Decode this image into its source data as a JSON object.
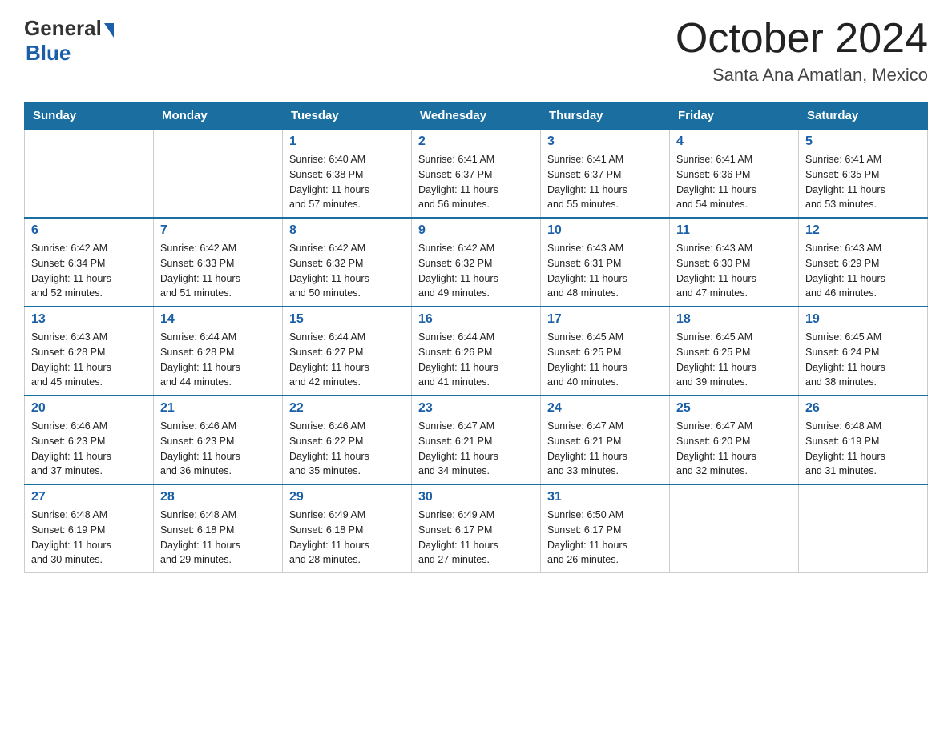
{
  "header": {
    "logo_general": "General",
    "logo_blue": "Blue",
    "month_title": "October 2024",
    "location": "Santa Ana Amatlan, Mexico"
  },
  "days_of_week": [
    "Sunday",
    "Monday",
    "Tuesday",
    "Wednesday",
    "Thursday",
    "Friday",
    "Saturday"
  ],
  "weeks": [
    [
      {
        "day": "",
        "info": ""
      },
      {
        "day": "",
        "info": ""
      },
      {
        "day": "1",
        "info": "Sunrise: 6:40 AM\nSunset: 6:38 PM\nDaylight: 11 hours\nand 57 minutes."
      },
      {
        "day": "2",
        "info": "Sunrise: 6:41 AM\nSunset: 6:37 PM\nDaylight: 11 hours\nand 56 minutes."
      },
      {
        "day": "3",
        "info": "Sunrise: 6:41 AM\nSunset: 6:37 PM\nDaylight: 11 hours\nand 55 minutes."
      },
      {
        "day": "4",
        "info": "Sunrise: 6:41 AM\nSunset: 6:36 PM\nDaylight: 11 hours\nand 54 minutes."
      },
      {
        "day": "5",
        "info": "Sunrise: 6:41 AM\nSunset: 6:35 PM\nDaylight: 11 hours\nand 53 minutes."
      }
    ],
    [
      {
        "day": "6",
        "info": "Sunrise: 6:42 AM\nSunset: 6:34 PM\nDaylight: 11 hours\nand 52 minutes."
      },
      {
        "day": "7",
        "info": "Sunrise: 6:42 AM\nSunset: 6:33 PM\nDaylight: 11 hours\nand 51 minutes."
      },
      {
        "day": "8",
        "info": "Sunrise: 6:42 AM\nSunset: 6:32 PM\nDaylight: 11 hours\nand 50 minutes."
      },
      {
        "day": "9",
        "info": "Sunrise: 6:42 AM\nSunset: 6:32 PM\nDaylight: 11 hours\nand 49 minutes."
      },
      {
        "day": "10",
        "info": "Sunrise: 6:43 AM\nSunset: 6:31 PM\nDaylight: 11 hours\nand 48 minutes."
      },
      {
        "day": "11",
        "info": "Sunrise: 6:43 AM\nSunset: 6:30 PM\nDaylight: 11 hours\nand 47 minutes."
      },
      {
        "day": "12",
        "info": "Sunrise: 6:43 AM\nSunset: 6:29 PM\nDaylight: 11 hours\nand 46 minutes."
      }
    ],
    [
      {
        "day": "13",
        "info": "Sunrise: 6:43 AM\nSunset: 6:28 PM\nDaylight: 11 hours\nand 45 minutes."
      },
      {
        "day": "14",
        "info": "Sunrise: 6:44 AM\nSunset: 6:28 PM\nDaylight: 11 hours\nand 44 minutes."
      },
      {
        "day": "15",
        "info": "Sunrise: 6:44 AM\nSunset: 6:27 PM\nDaylight: 11 hours\nand 42 minutes."
      },
      {
        "day": "16",
        "info": "Sunrise: 6:44 AM\nSunset: 6:26 PM\nDaylight: 11 hours\nand 41 minutes."
      },
      {
        "day": "17",
        "info": "Sunrise: 6:45 AM\nSunset: 6:25 PM\nDaylight: 11 hours\nand 40 minutes."
      },
      {
        "day": "18",
        "info": "Sunrise: 6:45 AM\nSunset: 6:25 PM\nDaylight: 11 hours\nand 39 minutes."
      },
      {
        "day": "19",
        "info": "Sunrise: 6:45 AM\nSunset: 6:24 PM\nDaylight: 11 hours\nand 38 minutes."
      }
    ],
    [
      {
        "day": "20",
        "info": "Sunrise: 6:46 AM\nSunset: 6:23 PM\nDaylight: 11 hours\nand 37 minutes."
      },
      {
        "day": "21",
        "info": "Sunrise: 6:46 AM\nSunset: 6:23 PM\nDaylight: 11 hours\nand 36 minutes."
      },
      {
        "day": "22",
        "info": "Sunrise: 6:46 AM\nSunset: 6:22 PM\nDaylight: 11 hours\nand 35 minutes."
      },
      {
        "day": "23",
        "info": "Sunrise: 6:47 AM\nSunset: 6:21 PM\nDaylight: 11 hours\nand 34 minutes."
      },
      {
        "day": "24",
        "info": "Sunrise: 6:47 AM\nSunset: 6:21 PM\nDaylight: 11 hours\nand 33 minutes."
      },
      {
        "day": "25",
        "info": "Sunrise: 6:47 AM\nSunset: 6:20 PM\nDaylight: 11 hours\nand 32 minutes."
      },
      {
        "day": "26",
        "info": "Sunrise: 6:48 AM\nSunset: 6:19 PM\nDaylight: 11 hours\nand 31 minutes."
      }
    ],
    [
      {
        "day": "27",
        "info": "Sunrise: 6:48 AM\nSunset: 6:19 PM\nDaylight: 11 hours\nand 30 minutes."
      },
      {
        "day": "28",
        "info": "Sunrise: 6:48 AM\nSunset: 6:18 PM\nDaylight: 11 hours\nand 29 minutes."
      },
      {
        "day": "29",
        "info": "Sunrise: 6:49 AM\nSunset: 6:18 PM\nDaylight: 11 hours\nand 28 minutes."
      },
      {
        "day": "30",
        "info": "Sunrise: 6:49 AM\nSunset: 6:17 PM\nDaylight: 11 hours\nand 27 minutes."
      },
      {
        "day": "31",
        "info": "Sunrise: 6:50 AM\nSunset: 6:17 PM\nDaylight: 11 hours\nand 26 minutes."
      },
      {
        "day": "",
        "info": ""
      },
      {
        "day": "",
        "info": ""
      }
    ]
  ]
}
